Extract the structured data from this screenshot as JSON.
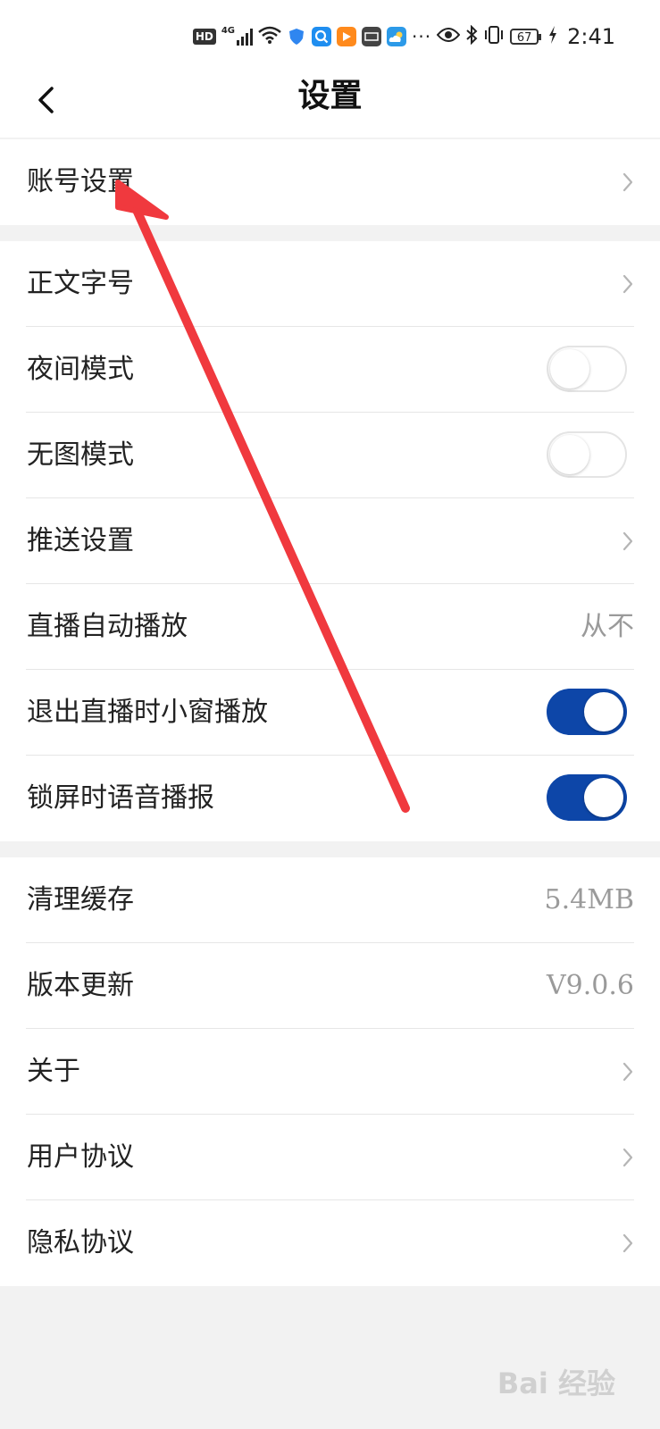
{
  "status_bar": {
    "hd": "HD",
    "network": "4G",
    "battery": "67",
    "time": "2:41",
    "icons": [
      "hd-icon",
      "signal-icon",
      "wifi-icon",
      "shield-app-icon",
      "search-app-icon",
      "video-app-icon",
      "huawei-app-icon",
      "weather-app-icon",
      "more-icon",
      "eye-icon",
      "bluetooth-icon",
      "vibrate-icon",
      "battery-icon",
      "charging-icon"
    ]
  },
  "header": {
    "title": "设置",
    "back_icon": "chevron-left-icon"
  },
  "groups": [
    {
      "rows": [
        {
          "label": "账号设置",
          "type": "chevron"
        }
      ]
    },
    {
      "rows": [
        {
          "label": "正文字号",
          "type": "chevron"
        },
        {
          "label": "夜间模式",
          "type": "toggle",
          "on": false
        },
        {
          "label": "无图模式",
          "type": "toggle",
          "on": false
        },
        {
          "label": "推送设置",
          "type": "chevron"
        },
        {
          "label": "直播自动播放",
          "type": "value",
          "value": "从不"
        },
        {
          "label": "退出直播时小窗播放",
          "type": "toggle",
          "on": true
        },
        {
          "label": "锁屏时语音播报",
          "type": "toggle",
          "on": true
        }
      ]
    },
    {
      "rows": [
        {
          "label": "清理缓存",
          "type": "value",
          "value": "5.4MB"
        },
        {
          "label": "版本更新",
          "type": "value",
          "value": "V9.0.6"
        },
        {
          "label": "关于",
          "type": "chevron"
        },
        {
          "label": "用户协议",
          "type": "chevron"
        },
        {
          "label": "隐私协议",
          "type": "chevron"
        }
      ]
    }
  ],
  "colors": {
    "toggle_on": "#0d46a8",
    "annotation_arrow": "#f0393e"
  },
  "watermark": "Bai 经验"
}
